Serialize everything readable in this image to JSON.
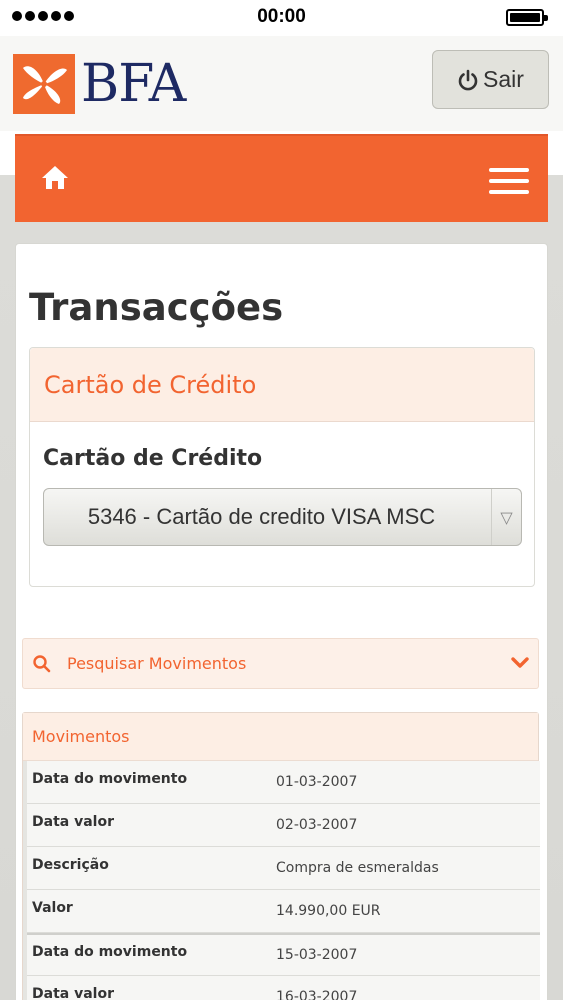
{
  "status_bar": {
    "time": "00:00"
  },
  "header": {
    "logo_text": "BFA",
    "logout_label": "Sair"
  },
  "page": {
    "title": "Transacções"
  },
  "credit_card_panel": {
    "heading": "Cartão de Crédito",
    "field_label": "Cartão de Crédito",
    "selected_card": "5346 - Cartão de credito VISA MSC"
  },
  "search": {
    "label": "Pesquisar Movimentos"
  },
  "movements": {
    "heading": "Movimentos",
    "entries": [
      {
        "rows": [
          {
            "label": "Data do movimento",
            "value": "01-03-2007"
          },
          {
            "label": "Data valor",
            "value": "02-03-2007"
          },
          {
            "label": "Descrição",
            "value": "Compra de esmeraldas"
          },
          {
            "label": "Valor",
            "value": "14.990,00 EUR"
          }
        ]
      },
      {
        "rows": [
          {
            "label": "Data do movimento",
            "value": "15-03-2007"
          },
          {
            "label": "Data valor",
            "value": "16-03-2007"
          }
        ]
      }
    ]
  },
  "colors": {
    "accent": "#f26430",
    "panel_header_bg": "#fdeee4",
    "logo_blue": "#1e2a63"
  },
  "icons": {
    "home": "home-icon",
    "menu": "hamburger-menu-icon",
    "power": "power-icon",
    "search": "search-icon",
    "expand": "chevron-down-icon"
  }
}
